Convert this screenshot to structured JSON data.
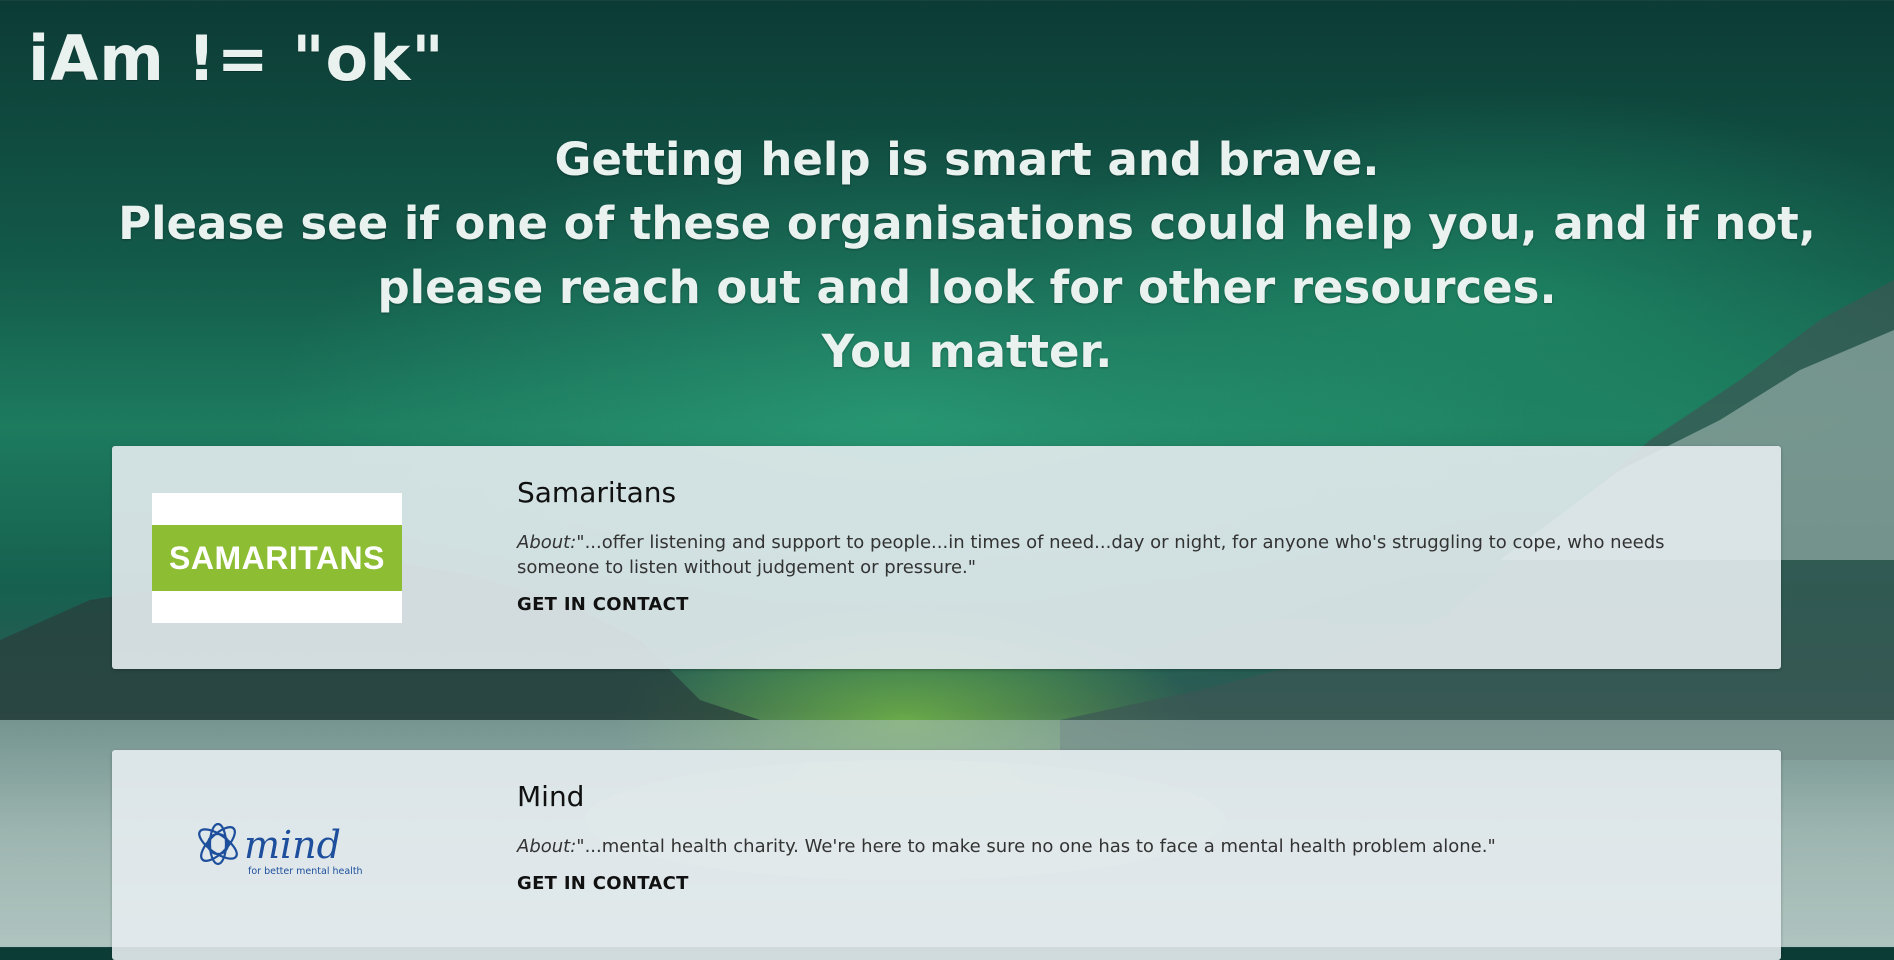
{
  "header": {
    "logo_text": "iAm != \"ok\""
  },
  "hero": {
    "line1": "Getting help is smart and brave.",
    "line2": "Please see if one of these organisations could help you, and if not, please reach out and look for other resources.",
    "line3": "You matter."
  },
  "organisations": [
    {
      "name": "Samaritans",
      "logo_text": "SAMARITANS",
      "about_label": "About:",
      "about_text": "\"...offer listening and support to people...in times of need...day or night, for anyone who's struggling to cope, who needs someone to listen without judgement or pressure.\"",
      "contact_label": "GET IN CONTACT",
      "brand_color": "#8cbd33"
    },
    {
      "name": "Mind",
      "logo_text": "mind",
      "logo_tagline": "for better mental health",
      "about_label": "About:",
      "about_text": "\"...mental health charity. We're here to make sure no one has to face a mental health problem alone.\"",
      "contact_label": "GET IN CONTACT",
      "brand_color": "#1d4f9c"
    }
  ]
}
